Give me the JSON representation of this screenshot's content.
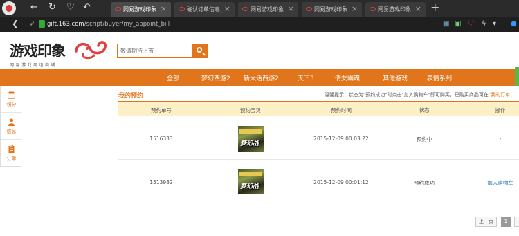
{
  "browser": {
    "tabs": [
      {
        "label": "网易游戏印象",
        "active": true
      },
      {
        "label": "确认订单信息_网",
        "active": false
      },
      {
        "label": "网易游戏印象",
        "active": false
      },
      {
        "label": "网易游戏印象",
        "active": false
      },
      {
        "label": "网易游戏印象",
        "active": false
      }
    ],
    "new_tab": "+",
    "close_glyph": "×",
    "url_host": "gift.163.com",
    "url_path": "/script/buyer/my_appoint_bill"
  },
  "header": {
    "logo_title": "游戏印象",
    "logo_subtitle": "网易游戏周边商城",
    "search_placeholder": "敬请期待上市"
  },
  "nav": {
    "items": [
      "全部",
      "梦幻西游2",
      "新大话西游2",
      "天下3",
      "倩女幽魂",
      "其他游戏",
      "表情系列"
    ]
  },
  "sidebar": {
    "items": [
      {
        "label": "积分",
        "icon": "points-icon"
      },
      {
        "label": "信息",
        "icon": "user-icon"
      },
      {
        "label": "订单",
        "icon": "order-icon"
      }
    ]
  },
  "main": {
    "title": "我的预约",
    "tip_prefix": "温馨提示：状态为\"预约成功\"时点击\"加入购物车\"即可购买，已购买商品可在",
    "tip_link": "\"我的订单",
    "columns": [
      "预约单号",
      "预约宝贝",
      "预约时间",
      "状态",
      "操作"
    ],
    "rows": [
      {
        "id": "1516333",
        "product_art_text": "梦幻战",
        "time": "2015-12-09 00:03:22",
        "status": "预约中",
        "action": "-"
      },
      {
        "id": "1513982",
        "product_art_text": "梦幻战",
        "time": "2015-12-09 00:01:12",
        "status": "预约成功",
        "action": "加入购物车"
      }
    ]
  },
  "pager": {
    "prev": "上一页",
    "current": "1"
  },
  "colors": {
    "accent": "#e0751c",
    "table_header_bg": "#fdf0c6",
    "link": "#2a7ab0"
  }
}
